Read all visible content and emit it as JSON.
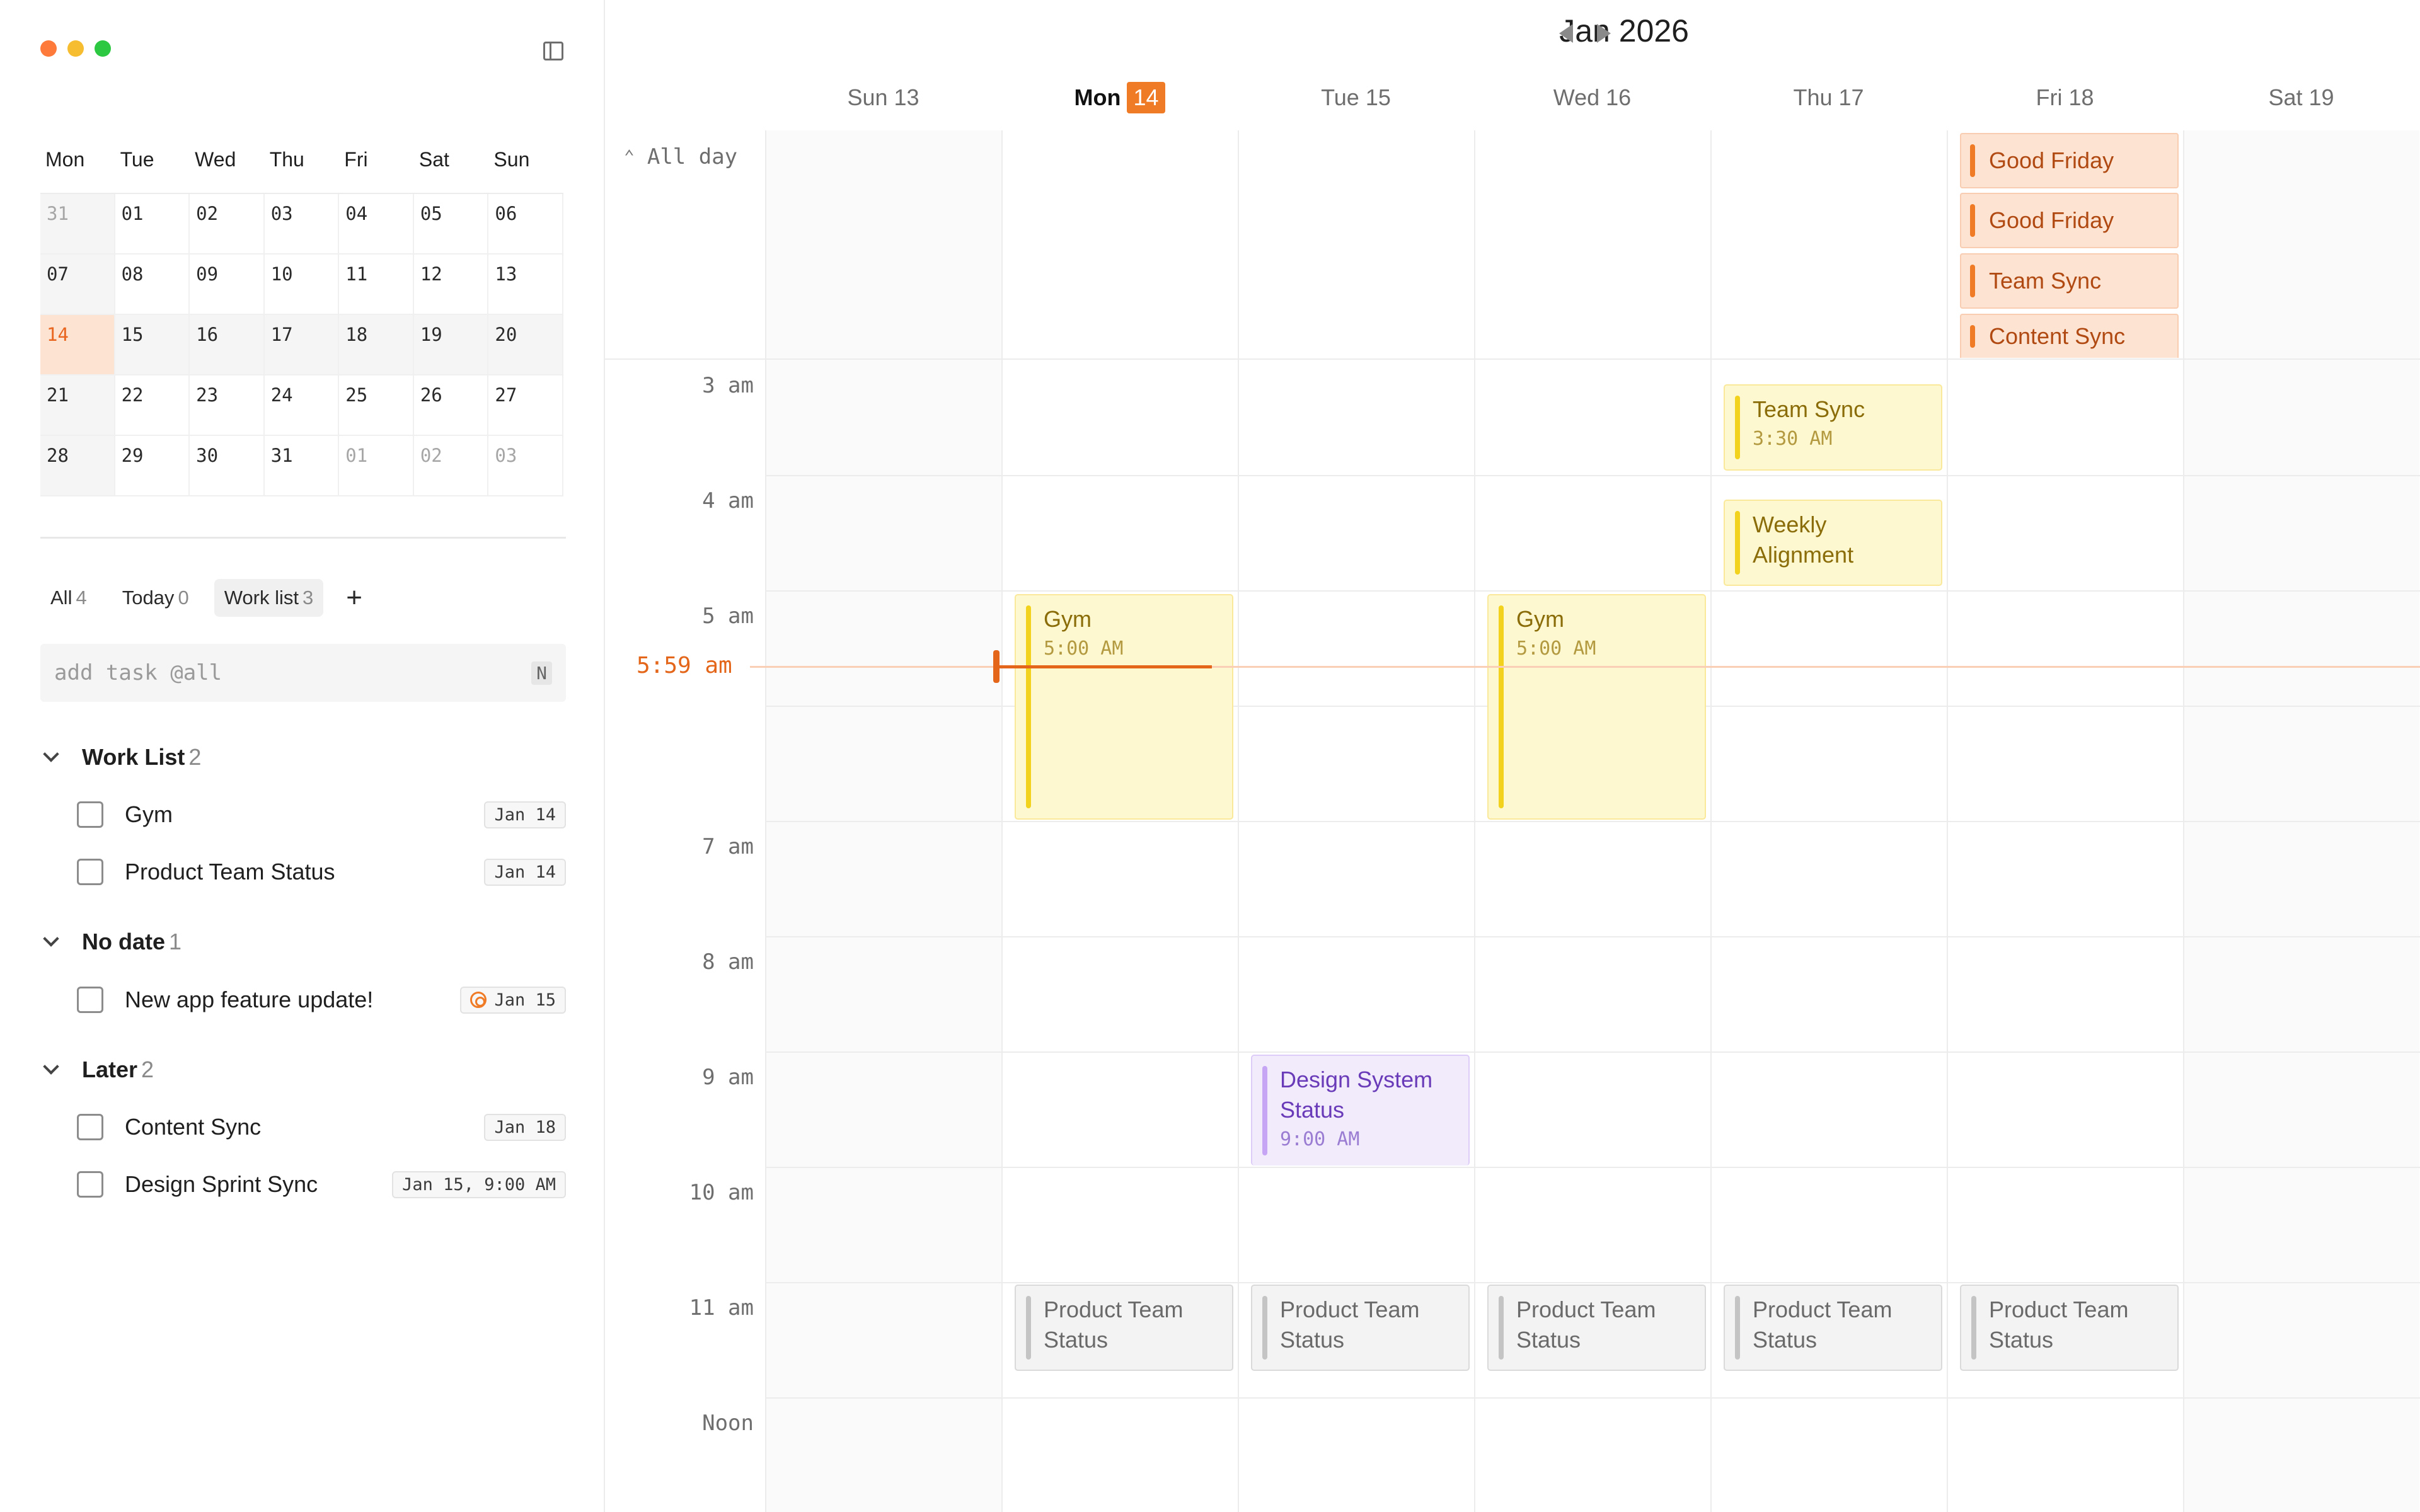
{
  "window": {
    "close": "close",
    "minimize": "minimize",
    "maximize": "maximize"
  },
  "mini_calendar": {
    "weekdays": [
      "Mon",
      "Tue",
      "Wed",
      "Thu",
      "Fri",
      "Sat",
      "Sun"
    ],
    "weeks": [
      [
        "31",
        "01",
        "02",
        "03",
        "04",
        "05",
        "06"
      ],
      [
        "07",
        "08",
        "09",
        "10",
        "11",
        "12",
        "13"
      ],
      [
        "14",
        "15",
        "16",
        "17",
        "18",
        "19",
        "20"
      ],
      [
        "21",
        "22",
        "23",
        "24",
        "25",
        "26",
        "27"
      ],
      [
        "28",
        "29",
        "30",
        "31",
        "01",
        "02",
        "03"
      ]
    ],
    "today": "14"
  },
  "tabs": [
    {
      "label": "All",
      "count": "4"
    },
    {
      "label": "Today",
      "count": "0"
    },
    {
      "label": "Work list",
      "count": "3"
    }
  ],
  "add_tab_label": "+",
  "add_task": {
    "placeholder": "add task @all",
    "shortcut": "N"
  },
  "groups": [
    {
      "title": "Work List",
      "count": "2",
      "tasks": [
        {
          "label": "Gym",
          "date": "Jan 14"
        },
        {
          "label": "Product Team Status",
          "date": "Jan 14"
        }
      ]
    },
    {
      "title": "No date",
      "count": "1",
      "tasks": [
        {
          "label": "New app feature update!",
          "date": "Jan 15"
        }
      ]
    },
    {
      "title": "Later",
      "count": "2",
      "tasks": [
        {
          "label": "Content Sync",
          "date": "Jan 18"
        },
        {
          "label": "Design Sprint Sync",
          "date": "Jan 15, 9:00 AM"
        }
      ]
    }
  ],
  "calendar": {
    "month_title": "Jan 2026",
    "days": [
      {
        "label": "Sun 13"
      },
      {
        "label": "Mon",
        "num": "14"
      },
      {
        "label": "Tue 15"
      },
      {
        "label": "Wed 16"
      },
      {
        "label": "Thu 17"
      },
      {
        "label": "Fri 18"
      },
      {
        "label": "Sat 19"
      }
    ],
    "all_day_label": "All day",
    "hours": [
      "3 am",
      "4 am",
      "5 am",
      "7 am",
      "8 am",
      "9 am",
      "10 am",
      "11 am",
      "Noon"
    ],
    "now_label": "5:59 am",
    "all_day_events": [
      "Good Friday",
      "Good Friday",
      "Team Sync",
      "Content Sync"
    ],
    "events": {
      "team_sync": {
        "title": "Team Sync",
        "time": "3:30 AM"
      },
      "weekly_alignment": {
        "title": "Weekly Alignment"
      },
      "gym_mon": {
        "title": "Gym",
        "time": "5:00 AM"
      },
      "gym_wed": {
        "title": "Gym",
        "time": "5:00 AM"
      },
      "design_system": {
        "title": "Design System Status",
        "time": "9:00 AM"
      },
      "product_team": [
        "Product Team Status",
        "Product Team Status",
        "Product Team Status",
        "Product Team Status",
        "Product Team Status"
      ]
    }
  },
  "colors": {
    "accent": "#f07b27",
    "now_line": "#e3661a",
    "yellow_event": "#fef8d0",
    "purple_event": "#f1ebfc"
  }
}
